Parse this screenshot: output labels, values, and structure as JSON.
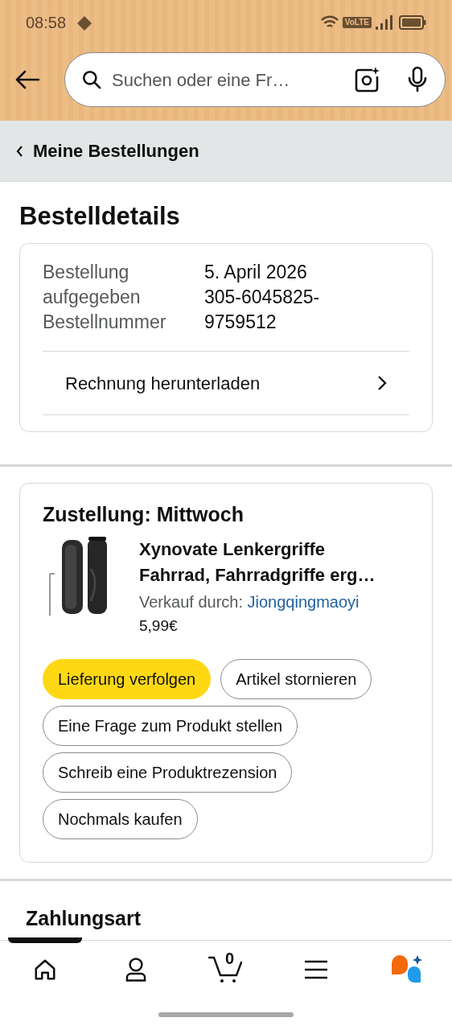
{
  "status_bar": {
    "time": "08:58",
    "network_badge": "VoLTE"
  },
  "search": {
    "placeholder": "Suchen oder eine Fr…"
  },
  "breadcrumb": {
    "label": "Meine Bestellungen"
  },
  "page_title": "Bestelldetails",
  "order_summary": {
    "labels": [
      "Bestellung aufgegeben",
      "Bestellnummer"
    ],
    "values": [
      "5. April 2026",
      "305-6045825-9759512"
    ],
    "invoice_link": "Rechnung herunterladen"
  },
  "shipment": {
    "title": "Zustellung: Mittwoch",
    "item": {
      "kind": "picture",
      "name": "Xynovate Lenkergriffe Fahrrad, Fahrradgriffe erg…",
      "seller_label": "Verkauf durch: ",
      "seller": "Jiongqingmaoyi",
      "price": "5,99€"
    },
    "actions": [
      {
        "label": "Lieferung verfolgen",
        "kind": "primary"
      },
      {
        "label": "Artikel stornieren",
        "kind": "secondary"
      },
      {
        "label": "Eine Frage zum Produkt stellen",
        "kind": "secondary"
      },
      {
        "label": "Schreib eine Produktrezension",
        "kind": "secondary"
      },
      {
        "label": "Nochmals kaufen",
        "kind": "secondary"
      }
    ]
  },
  "next_section_title": "Zahlungsart",
  "bottom_nav": [
    {
      "kind": "home",
      "selected": true
    },
    {
      "kind": "profile",
      "selected": false
    },
    {
      "kind": "cart",
      "count": "0",
      "selected": false
    },
    {
      "kind": "menu",
      "selected": false
    },
    {
      "kind": "assistant",
      "selected": false
    }
  ]
}
